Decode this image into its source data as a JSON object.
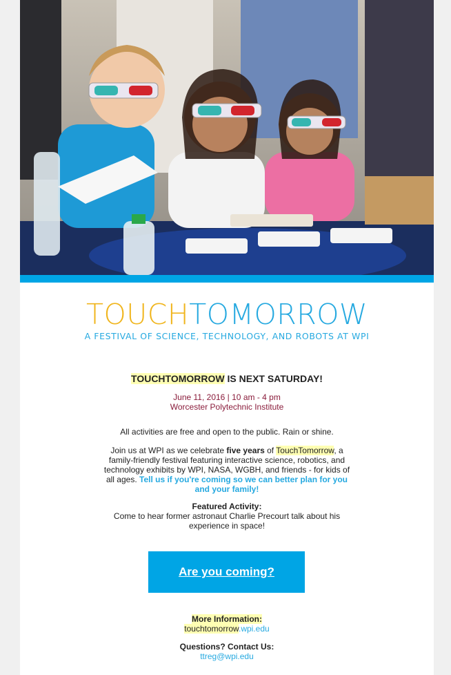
{
  "header": {
    "hero_alt_icon": "kids-with-3d-glasses-photo"
  },
  "logo": {
    "touch": "TOUCH",
    "tomorrow": "TOMORROW",
    "tagline": "A FESTIVAL OF SCIENCE, TECHNOLOGY, AND ROBOTS AT WPI"
  },
  "headline": {
    "highlight": "TOUCHTOMORROW",
    "rest": " IS NEXT SATURDAY!"
  },
  "event": {
    "date": "June 11, 2016 | 10 am - 4 pm",
    "venue": "Worcester Polytechnic Institute"
  },
  "body": {
    "intro": "All activities are free and open to the public. Rain or shine.",
    "p1_a": "Join us at WPI as we celebrate ",
    "p1_bold": "five years",
    "p1_b": " of ",
    "p1_highlight": "TouchTomorrow",
    "p1_c": ", a family-friendly festival featuring interactive science, robotics, and technology exhibits by WPI, NASA, WGBH, and friends - for kids of all ages. ",
    "p1_link": "Tell us if you're coming so we can better plan for you and your family!",
    "featured_label": "Featured Activity:",
    "featured_text": "Come to hear former astronaut Charlie Precourt talk about his experience in space!"
  },
  "cta": {
    "label": "Are you coming?"
  },
  "footer": {
    "more_label": "More Information:",
    "more_link_highlight": "touchtomorrow",
    "more_link_rest": ".wpi.edu",
    "questions_label": "Questions? Contact Us:",
    "email": "ttreg@wpi.edu"
  },
  "colors": {
    "brand_blue": "#00a5e5",
    "logo_yellow": "#f0b51d",
    "date_red": "#8a1c3b"
  }
}
